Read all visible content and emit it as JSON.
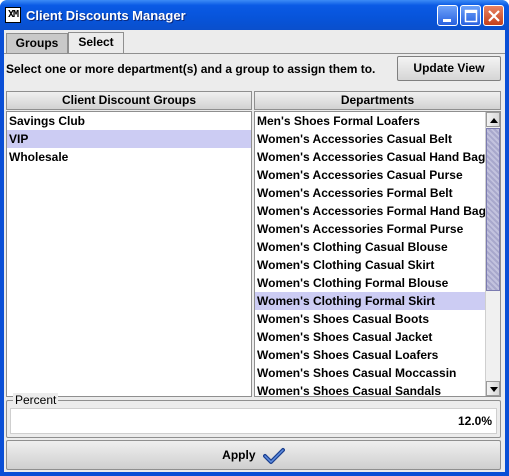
{
  "window": {
    "title": "Client Discounts Manager",
    "app_icon_text": "XM"
  },
  "tabs": [
    {
      "label": "Groups"
    },
    {
      "label": "Select"
    }
  ],
  "instruction": "Select one or more department(s) and a group to assign them to.",
  "update_view_label": "Update View",
  "groups_table": {
    "header": "Client Discount Groups",
    "rows": [
      "Savings Club",
      "VIP",
      "Wholesale"
    ],
    "selected_index": 1
  },
  "departments_table": {
    "header": "Departments",
    "rows": [
      "Men's Shoes Formal Loafers",
      "Women's Accessories Casual Belt",
      "Women's Accessories Casual Hand Bag",
      "Women's Accessories Casual Purse",
      "Women's Accessories Formal Belt",
      "Women's Accessories Formal Hand Bag",
      "Women's Accessories Formal Purse",
      "Women's Clothing Casual Blouse",
      "Women's Clothing Casual Skirt",
      "Women's Clothing Formal Blouse",
      "Women's Clothing Formal Skirt",
      "Women's Shoes Casual Boots",
      "Women's Shoes Casual Jacket",
      "Women's Shoes Casual Loafers",
      "Women's Shoes Casual Moccassin",
      "Women's Shoes Casual Sandals"
    ],
    "selected_index": 10
  },
  "percent": {
    "label": "Percent",
    "value": "12.0%"
  },
  "apply_label": "Apply",
  "icons": {
    "apply": "checkmark-icon",
    "app": "app-logo-icon"
  },
  "colors": {
    "selection": "#ccccf3",
    "titlebar": "#0754da"
  }
}
